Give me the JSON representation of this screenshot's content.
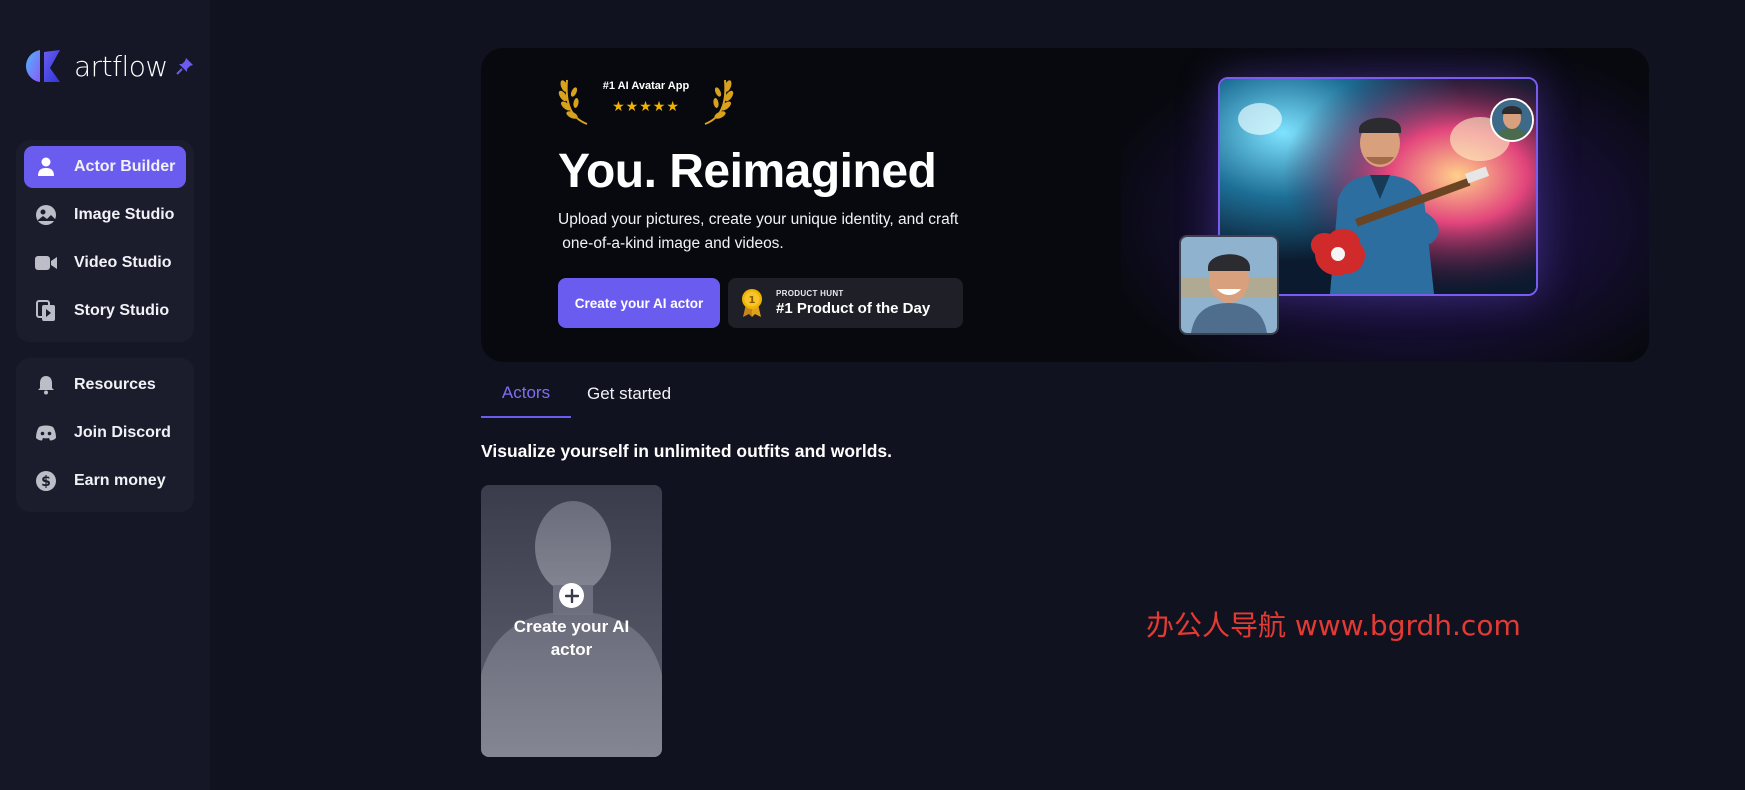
{
  "brand": {
    "name": "artflow",
    "accent": "#6b5cf0"
  },
  "sidebar": {
    "primary": [
      {
        "label": "Actor Builder",
        "icon": "person-icon",
        "active": true
      },
      {
        "label": "Image Studio",
        "icon": "image-studio-icon",
        "active": false
      },
      {
        "label": "Video Studio",
        "icon": "video-camera-icon",
        "active": false
      },
      {
        "label": "Story Studio",
        "icon": "story-icon",
        "active": false
      }
    ],
    "secondary": [
      {
        "label": "Resources",
        "icon": "bell-icon"
      },
      {
        "label": "Join Discord",
        "icon": "discord-icon"
      },
      {
        "label": "Earn money",
        "icon": "dollar-icon"
      }
    ]
  },
  "hero": {
    "award_title": "#1 AI Avatar App",
    "award_stars": "★★★★★",
    "title": "You. Reimagined",
    "subtitle_line1": "Upload your pictures, create your unique identity, and craft",
    "subtitle_line2": " one-of-a-kind image and videos.",
    "cta_label": "Create your AI actor",
    "badge_small": "PRODUCT HUNT",
    "badge_big": "#1 Product of the Day",
    "badge_medal_number": "1"
  },
  "tabs": [
    {
      "label": "Actors",
      "active": true
    },
    {
      "label": "Get started",
      "active": false
    }
  ],
  "section_heading": "Visualize yourself in unlimited outfits and worlds.",
  "create_card": {
    "label": "Create your AI actor"
  },
  "watermark": "办公人导航 www.bgrdh.com"
}
